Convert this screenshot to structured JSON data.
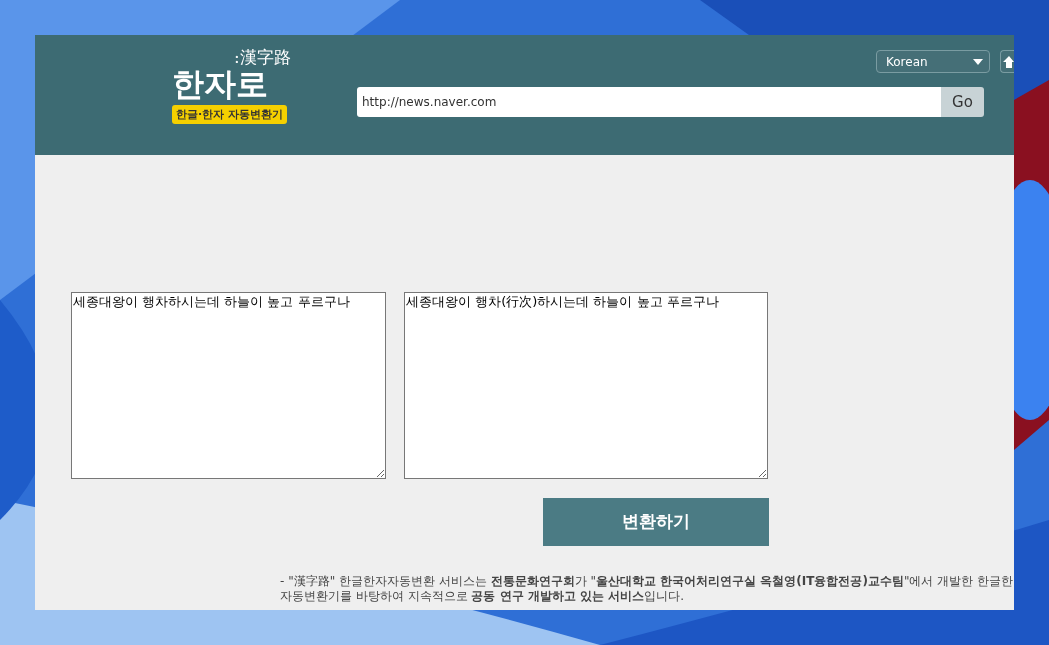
{
  "logo": {
    "hanja": ":漢字路",
    "title": "한자로",
    "badge": "한글·한자 자동변환기"
  },
  "language_select": {
    "value": "Korean"
  },
  "url_field": {
    "value": "http://news.naver.com"
  },
  "go_button": "Go",
  "input_text": "세종대왕이 행차하시는데 하늘이 높고 푸르구나",
  "output_text": "세종대왕이 행차(行次)하시는데 하늘이 높고 푸르구나",
  "convert_button": "변환하기",
  "notes": [
    "- \"漢字路\" 한글한자자동변환 서비스는 **전통문화연구회**가 \"**울산대학교 한국어처리연구실 옥철영(IT융합전공)교수팀**\"에서 개발한 한글한",
    "자동변환기를 바탕하여 지속적으로 **공동 연구 개발하고 있는 서비스**입니다."
  ]
}
